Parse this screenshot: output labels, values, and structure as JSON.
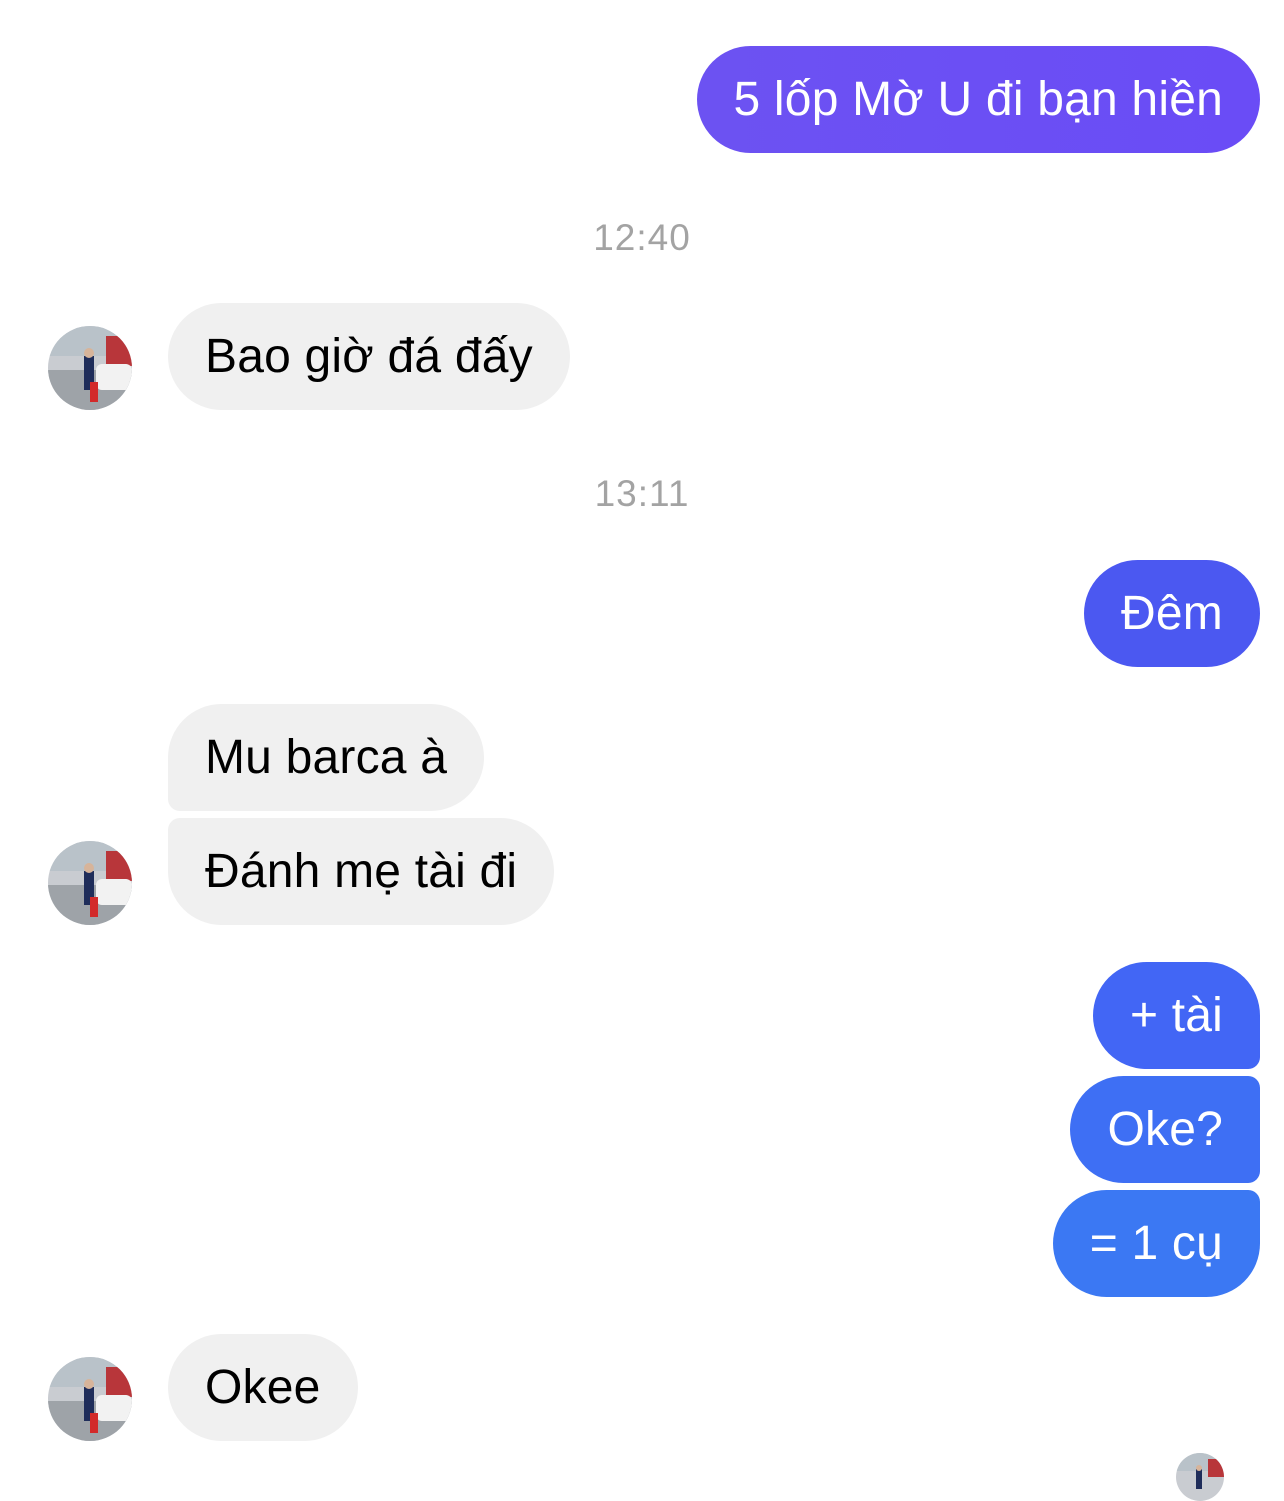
{
  "conversation": {
    "messages": [
      {
        "direction": "outgoing",
        "text": "5 lốp Mờ U đi bạn hiền"
      },
      {
        "type": "timestamp",
        "text": "12:40"
      },
      {
        "direction": "incoming",
        "text": "Bao giờ đá đấy"
      },
      {
        "type": "timestamp",
        "text": "13:11"
      },
      {
        "direction": "outgoing",
        "text": "Đêm"
      },
      {
        "direction": "incoming",
        "text": "Mu barca à"
      },
      {
        "direction": "incoming",
        "text": "Đánh mẹ tài đi"
      },
      {
        "direction": "outgoing",
        "text": "+ tài"
      },
      {
        "direction": "outgoing",
        "text": "Oke?"
      },
      {
        "direction": "outgoing",
        "text": "= 1 cụ"
      },
      {
        "direction": "incoming",
        "text": "Okee"
      }
    ]
  },
  "colors": {
    "outgoing_gradient_top": "#7a4cf6",
    "outgoing_gradient_bottom": "#3a78f2",
    "incoming_bubble": "#f0f0f0",
    "timestamp_text": "#a3a3a3"
  },
  "icons": {
    "avatar": "contact-avatar-photo",
    "read_receipt": "read-receipt-avatar"
  }
}
